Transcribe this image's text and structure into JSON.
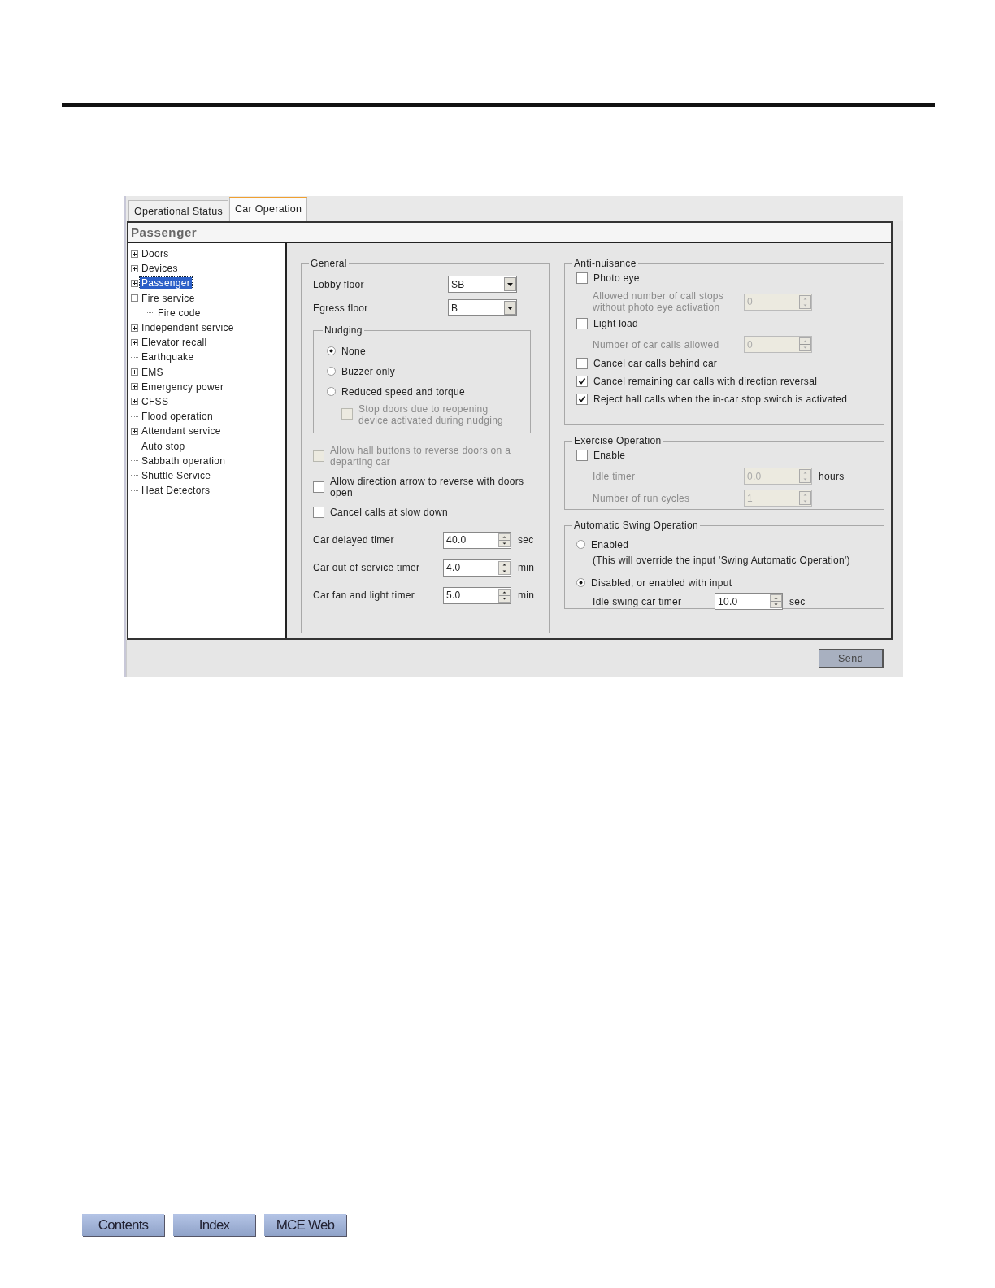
{
  "tabs": [
    {
      "label": "Operational Status",
      "selected": false
    },
    {
      "label": "Car Operation",
      "selected": true
    }
  ],
  "panel_title": "Passenger",
  "tree": [
    {
      "label": "Doors",
      "kind": "node",
      "expanded": false,
      "selected": false
    },
    {
      "label": "Devices",
      "kind": "node",
      "expanded": false,
      "selected": false
    },
    {
      "label": "Passenger",
      "kind": "node",
      "expanded": false,
      "selected": true
    },
    {
      "label": "Fire service",
      "kind": "node",
      "expanded": true,
      "selected": false,
      "children": [
        {
          "label": "Fire code",
          "kind": "leaf",
          "selected": false
        }
      ]
    },
    {
      "label": "Independent service",
      "kind": "node",
      "expanded": false,
      "selected": false
    },
    {
      "label": "Elevator recall",
      "kind": "node",
      "expanded": false,
      "selected": false
    },
    {
      "label": "Earthquake",
      "kind": "leaf",
      "selected": false
    },
    {
      "label": "EMS",
      "kind": "node",
      "expanded": false,
      "selected": false
    },
    {
      "label": "Emergency power",
      "kind": "node",
      "expanded": false,
      "selected": false
    },
    {
      "label": "CFSS",
      "kind": "node",
      "expanded": false,
      "selected": false
    },
    {
      "label": "Flood operation",
      "kind": "leaf",
      "selected": false
    },
    {
      "label": "Attendant service",
      "kind": "node",
      "expanded": false,
      "selected": false
    },
    {
      "label": "Auto stop",
      "kind": "leaf",
      "selected": false
    },
    {
      "label": "Sabbath operation",
      "kind": "leaf",
      "selected": false
    },
    {
      "label": "Shuttle Service",
      "kind": "leaf",
      "selected": false
    },
    {
      "label": "Heat Detectors",
      "kind": "leaf",
      "selected": false
    }
  ],
  "general": {
    "title": "General",
    "dropdowns": [
      {
        "label": "Lobby floor",
        "value": "SB"
      },
      {
        "label": "Egress floor",
        "value": "B"
      }
    ],
    "nudging": {
      "title": "Nudging",
      "options": [
        {
          "label": "None",
          "selected": true
        },
        {
          "label": "Buzzer only",
          "selected": false
        },
        {
          "label": "Reduced speed and torque",
          "selected": false
        }
      ],
      "sub_option": {
        "label": "Stop doors due to reopening device activated during nudging",
        "checked": false,
        "disabled": true
      }
    },
    "checkboxes": [
      {
        "label": "Allow hall buttons to reverse doors on a departing car",
        "checked": false,
        "disabled": true
      },
      {
        "label": "Allow direction arrow to reverse with doors open",
        "checked": false,
        "disabled": false
      },
      {
        "label": "Cancel calls at slow down",
        "checked": false,
        "disabled": false
      }
    ],
    "timers": [
      {
        "label": "Car delayed timer",
        "value": "40.0",
        "unit": "sec"
      },
      {
        "label": "Car out of service timer",
        "value": "4.0",
        "unit": "min"
      },
      {
        "label": "Car fan and light timer",
        "value": "5.0",
        "unit": "min"
      }
    ]
  },
  "anti_nuisance": {
    "title": "Anti-nuisance",
    "items": [
      {
        "kind": "checkbox",
        "label": "Photo eye",
        "checked": false
      },
      {
        "kind": "spinner",
        "label": "Allowed number of call stops without photo eye activation",
        "value": "0",
        "disabled": true
      },
      {
        "kind": "checkbox",
        "label": "Light load",
        "checked": false
      },
      {
        "kind": "spinner",
        "label": "Number of car calls allowed",
        "value": "0",
        "disabled": true
      },
      {
        "kind": "checkbox",
        "label": "Cancel car calls behind car",
        "checked": false
      },
      {
        "kind": "checkbox",
        "label": "Cancel remaining car calls with direction reversal",
        "checked": true
      },
      {
        "kind": "checkbox",
        "label": "Reject hall calls when the in-car stop switch is activated",
        "checked": true
      }
    ]
  },
  "exercise_operation": {
    "title": "Exercise Operation",
    "items": [
      {
        "kind": "checkbox",
        "label": "Enable",
        "checked": false
      },
      {
        "kind": "spinner",
        "label": "Idle timer",
        "value": "0.0",
        "unit": "hours",
        "disabled": true
      },
      {
        "kind": "spinner",
        "label": "Number of run cycles",
        "value": "1",
        "disabled": true
      }
    ]
  },
  "automatic_swing_operation": {
    "title": "Automatic Swing Operation",
    "options": [
      {
        "label": "Enabled",
        "note": "(This will override the input 'Swing Automatic Operation')",
        "selected": false
      },
      {
        "label": "Disabled, or enabled with input",
        "selected": true
      }
    ],
    "timer": {
      "label": "Idle swing car timer",
      "value": "10.0",
      "unit": "sec"
    }
  },
  "send_button": "Send",
  "nav_buttons": [
    "Contents",
    "Index",
    "MCE Web"
  ]
}
